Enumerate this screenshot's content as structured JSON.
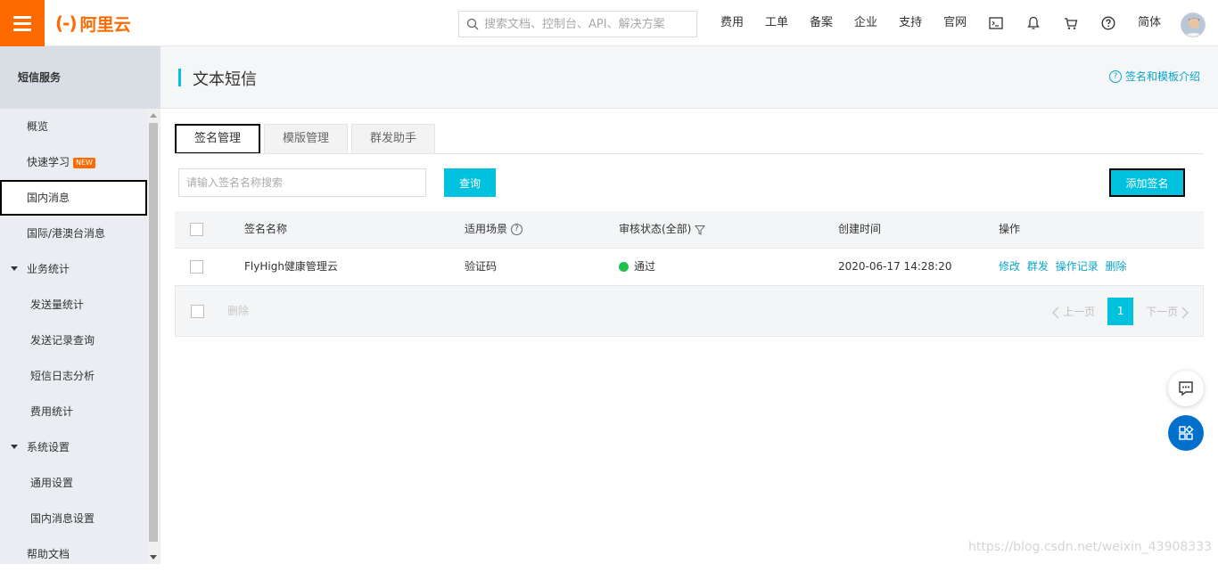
{
  "topbar": {
    "logo_text": "阿里云",
    "logo_mark": "(-)",
    "search_placeholder": "搜索文档、控制台、API、解决方案",
    "nav": [
      "费用",
      "工单",
      "备案",
      "企业",
      "支持",
      "官网"
    ],
    "lang": "简体",
    "icons": [
      "terminal-icon",
      "bell-icon",
      "cart-icon",
      "help-icon"
    ]
  },
  "sidebar": {
    "title": "短信服务",
    "items": [
      {
        "label": "概览"
      },
      {
        "label": "快速学习",
        "badge": "NEW"
      },
      {
        "label": "国内消息"
      },
      {
        "label": "国际/港澳台消息"
      },
      {
        "label": "业务统计"
      },
      {
        "label": "发送量统计"
      },
      {
        "label": "发送记录查询"
      },
      {
        "label": "短信日志分析"
      },
      {
        "label": "费用统计"
      },
      {
        "label": "系统设置"
      },
      {
        "label": "通用设置"
      },
      {
        "label": "国内消息设置"
      },
      {
        "label": "帮助文档"
      }
    ]
  },
  "page": {
    "title": "文本短信",
    "help_link": "签名和模板介绍",
    "help_mark": "?"
  },
  "tabs": [
    "签名管理",
    "模版管理",
    "群发助手"
  ],
  "toolbar": {
    "search_placeholder": "请输入签名名称搜索",
    "query_label": "查询",
    "add_label": "添加签名"
  },
  "table": {
    "headers": [
      "签名名称",
      "适用场景",
      "审核状态(全部)",
      "创建时间",
      "操作"
    ],
    "help_mark": "?",
    "rows": [
      {
        "name": "FlyHigh健康管理云",
        "scene": "验证码",
        "status": "通过",
        "created": "2020-06-17 14:28:20",
        "actions": [
          "修改",
          "群发",
          "操作记录",
          "删除"
        ]
      }
    ]
  },
  "footer": {
    "delete_label": "删除",
    "prev_label": "上一页",
    "next_label": "下一页",
    "current_page": "1"
  },
  "watermark": "https://blog.csdn.net/weixin_43908333",
  "colors": {
    "brand": "#ff6a00",
    "accent": "#00c1de",
    "link": "#0aa5c9",
    "status_ok": "#1ec04e",
    "float_blue": "#0070cc"
  }
}
